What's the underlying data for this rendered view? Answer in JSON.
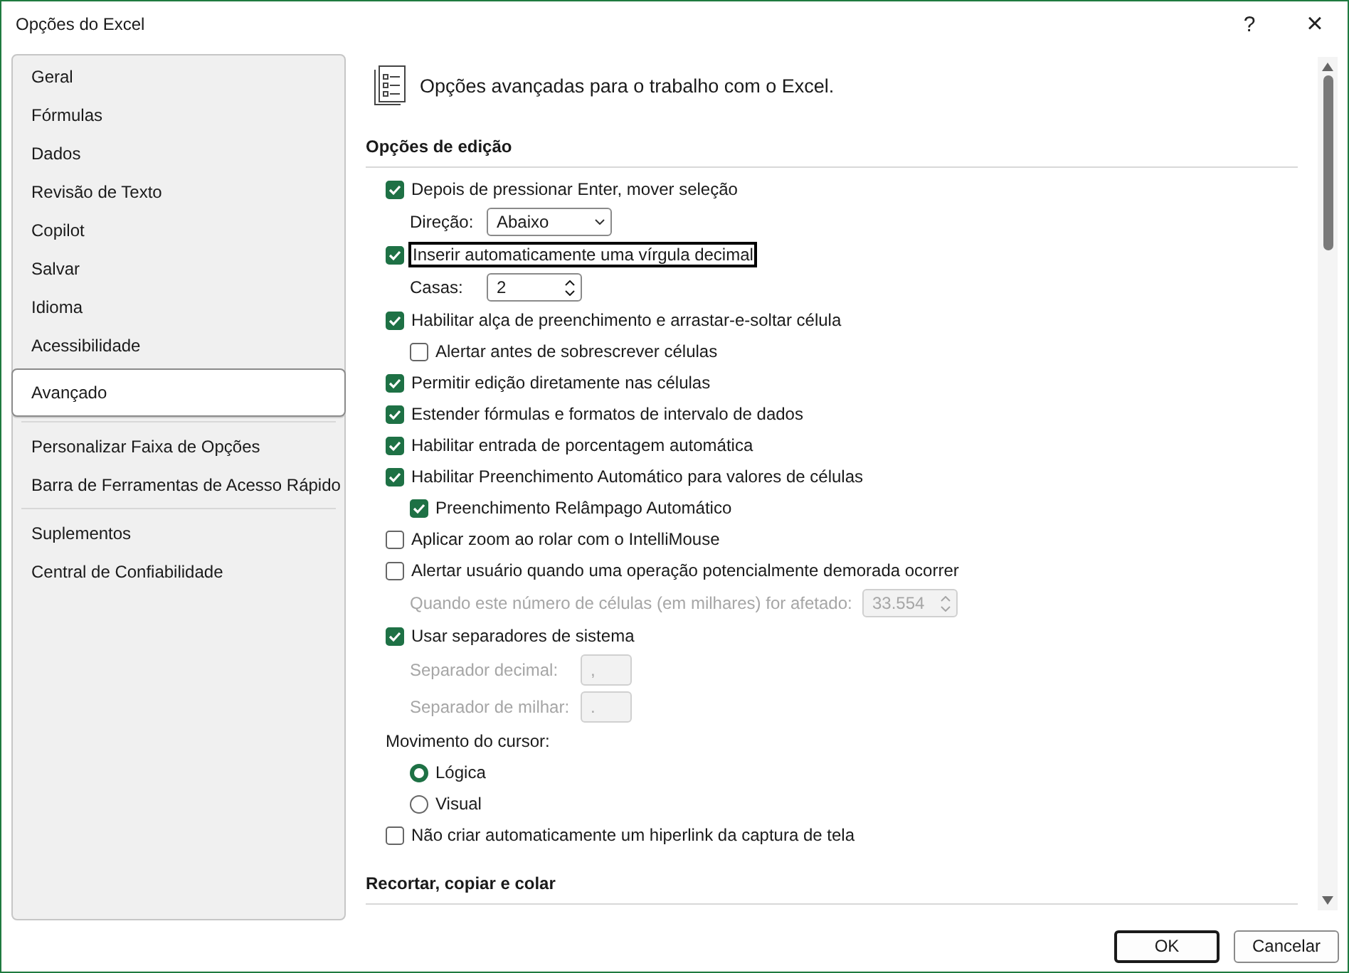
{
  "window": {
    "title": "Opções do Excel",
    "help": "?",
    "close": "×"
  },
  "sidebar": {
    "groups": [
      [
        {
          "label": "Geral",
          "selected": false
        },
        {
          "label": "Fórmulas",
          "selected": false
        },
        {
          "label": "Dados",
          "selected": false
        },
        {
          "label": "Revisão de Texto",
          "selected": false
        },
        {
          "label": "Copilot",
          "selected": false
        },
        {
          "label": "Salvar",
          "selected": false
        },
        {
          "label": "Idioma",
          "selected": false
        },
        {
          "label": "Acessibilidade",
          "selected": false
        },
        {
          "label": "Avançado",
          "selected": true
        }
      ],
      [
        {
          "label": "Personalizar Faixa de Opções",
          "selected": false
        },
        {
          "label": "Barra de Ferramentas de Acesso Rápido",
          "selected": false
        }
      ],
      [
        {
          "label": "Suplementos",
          "selected": false
        },
        {
          "label": "Central de Confiabilidade",
          "selected": false
        }
      ]
    ]
  },
  "header": {
    "title": "Opções avançadas para o trabalho com o Excel."
  },
  "sections": [
    {
      "title": "Opções de edição",
      "items": [
        {
          "kind": "checkbox",
          "label": "Depois de pressionar Enter, mover seleção",
          "checked": true,
          "focused": false,
          "children": [
            {
              "kind": "select",
              "label": "Direção:",
              "value": "Abaixo",
              "disabled": false
            }
          ]
        },
        {
          "kind": "checkbox",
          "label": "Inserir automaticamente uma vírgula decimal",
          "checked": true,
          "focused": true,
          "children": [
            {
              "kind": "spin",
              "label": "Casas:",
              "value": "2",
              "disabled": false
            }
          ]
        },
        {
          "kind": "checkbox",
          "label": "Habilitar alça de preenchimento e arrastar-e-soltar célula",
          "checked": true,
          "focused": false,
          "children": [
            {
              "kind": "checkbox",
              "label": "Alertar antes de sobrescrever células",
              "checked": false,
              "focused": false
            }
          ]
        },
        {
          "kind": "checkbox",
          "label": "Permitir edição diretamente nas células",
          "checked": true,
          "focused": false
        },
        {
          "kind": "checkbox",
          "label": "Estender fórmulas e formatos de intervalo de dados",
          "checked": true,
          "focused": false
        },
        {
          "kind": "checkbox",
          "label": "Habilitar entrada de porcentagem automática",
          "checked": true,
          "focused": false
        },
        {
          "kind": "checkbox",
          "label": "Habilitar Preenchimento Automático para valores de células",
          "checked": true,
          "focused": false,
          "children": [
            {
              "kind": "checkbox",
              "label": "Preenchimento Relâmpago Automático",
              "checked": true,
              "focused": false
            }
          ]
        },
        {
          "kind": "checkbox",
          "label": "Aplicar zoom ao rolar com o IntelliMouse",
          "checked": false,
          "focused": false
        },
        {
          "kind": "checkbox",
          "label": "Alertar usuário quando uma operação potencialmente demorada ocorrer",
          "checked": false,
          "focused": false,
          "children": [
            {
              "kind": "spin",
              "label": "Quando este número de células (em milhares) for afetado:",
              "value": "33.554",
              "disabled": true
            }
          ]
        },
        {
          "kind": "checkbox",
          "label": "Usar separadores de sistema",
          "checked": true,
          "focused": false,
          "children": [
            {
              "kind": "textfield",
              "label": "Separador decimal:",
              "value": ",",
              "disabled": true
            },
            {
              "kind": "textfield",
              "label": "Separador de milhar:",
              "value": ".",
              "disabled": true
            }
          ]
        },
        {
          "kind": "label",
          "label": "Movimento do cursor:",
          "children": [
            {
              "kind": "radio",
              "label": "Lógica",
              "selected": true
            },
            {
              "kind": "radio",
              "label": "Visual",
              "selected": false
            }
          ]
        },
        {
          "kind": "checkbox",
          "label": "Não criar automaticamente um hiperlink da captura de tela",
          "checked": false,
          "focused": false
        }
      ]
    },
    {
      "title": "Recortar, copiar e colar"
    }
  ],
  "buttons": [
    {
      "label": "OK",
      "primary": true
    },
    {
      "label": "Cancelar",
      "primary": false
    }
  ]
}
